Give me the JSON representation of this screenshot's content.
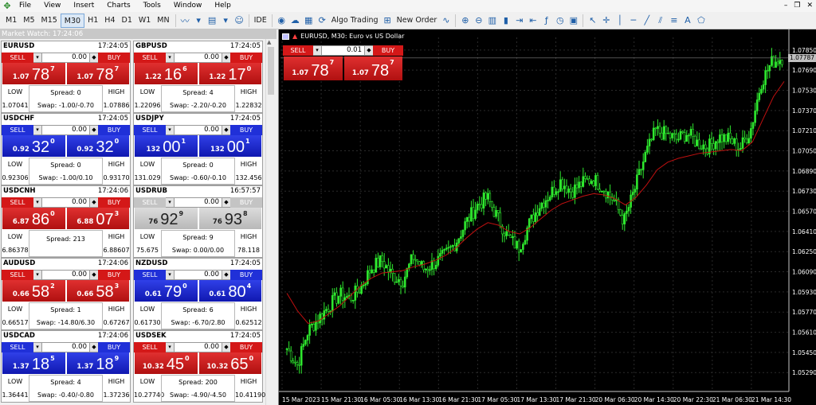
{
  "menu": {
    "items": [
      "File",
      "View",
      "Insert",
      "Charts",
      "Tools",
      "Window",
      "Help"
    ]
  },
  "toolbar": {
    "timeframes": [
      "M1",
      "M5",
      "M15",
      "M30",
      "H1",
      "H4",
      "D1",
      "W1",
      "MN"
    ],
    "active": "M30",
    "ide": "IDE",
    "algo": "Algo Trading",
    "new_order": "New Order"
  },
  "market_watch": {
    "title": "Market Watch: 17:24:06"
  },
  "panels": [
    {
      "symbol": "EURUSD",
      "time": "17:24:05",
      "lot": "0.00",
      "color": "red",
      "sell_label": "SELL",
      "buy_label": "BUY",
      "bid_pfx": "1.07",
      "bid_big": "78",
      "bid_sup": "7",
      "ask_pfx": "1.07",
      "ask_big": "78",
      "ask_sup": "7",
      "low_label": "LOW",
      "low": "1.07041",
      "spread": "Spread: 0",
      "swap": "Swap: -1.00/-0.70",
      "high_label": "HIGH",
      "high": "1.07886"
    },
    {
      "symbol": "GBPUSD",
      "time": "17:24:05",
      "lot": "0.00",
      "color": "red",
      "sell_label": "SELL",
      "buy_label": "BUY",
      "bid_pfx": "1.22",
      "bid_big": "16",
      "bid_sup": "6",
      "ask_pfx": "1.22",
      "ask_big": "17",
      "ask_sup": "0",
      "low_label": "LOW",
      "low": "1.22096",
      "spread": "Spread: 4",
      "swap": "Swap: -2.20/-0.20",
      "high_label": "HIGH",
      "high": "1.22832"
    },
    {
      "symbol": "USDCHF",
      "time": "17:24:05",
      "lot": "0.00",
      "color": "blue",
      "sell_label": "SELL",
      "buy_label": "BUY",
      "bid_pfx": "0.92",
      "bid_big": "32",
      "bid_sup": "0",
      "ask_pfx": "0.92",
      "ask_big": "32",
      "ask_sup": "0",
      "low_label": "LOW",
      "low": "0.92306",
      "spread": "Spread: 0",
      "swap": "Swap: -1.00/0.10",
      "high_label": "HIGH",
      "high": "0.93170"
    },
    {
      "symbol": "USDJPY",
      "time": "17:24:05",
      "lot": "0.00",
      "color": "blue",
      "sell_label": "SELL",
      "buy_label": "BUY",
      "bid_pfx": "132",
      "bid_big": "00",
      "bid_sup": "1",
      "ask_pfx": "132",
      "ask_big": "00",
      "ask_sup": "1",
      "low_label": "LOW",
      "low": "131.029",
      "spread": "Spread: 0",
      "swap": "Swap: -0.60/-0.10",
      "high_label": "HIGH",
      "high": "132.456"
    },
    {
      "symbol": "USDCNH",
      "time": "17:24:06",
      "lot": "0.00",
      "color": "red",
      "sell_label": "SELL",
      "buy_label": "BUY",
      "bid_pfx": "6.87",
      "bid_big": "86",
      "bid_sup": "0",
      "ask_pfx": "6.88",
      "ask_big": "07",
      "ask_sup": "3",
      "low_label": "LOW",
      "low": "6.86378",
      "spread": "Spread: 213",
      "swap": "",
      "high_label": "HIGH",
      "high": "6.88607"
    },
    {
      "symbol": "USDRUB",
      "time": "16:57:57",
      "lot": "0.00",
      "color": "gray",
      "sell_label": "SELL",
      "buy_label": "BUY",
      "bid_pfx": "76",
      "bid_big": "92",
      "bid_sup": "9",
      "ask_pfx": "76",
      "ask_big": "93",
      "ask_sup": "8",
      "low_label": "LOW",
      "low": "75.675",
      "spread": "Spread: 9",
      "swap": "Swap: 0.00/0.00",
      "high_label": "HIGH",
      "high": "78.118"
    },
    {
      "symbol": "AUDUSD",
      "time": "17:24:06",
      "lot": "0.00",
      "color": "red",
      "sell_label": "SELL",
      "buy_label": "BUY",
      "bid_pfx": "0.66",
      "bid_big": "58",
      "bid_sup": "2",
      "ask_pfx": "0.66",
      "ask_big": "58",
      "ask_sup": "3",
      "low_label": "LOW",
      "low": "0.66517",
      "spread": "Spread: 1",
      "swap": "Swap: -14.80/6.30",
      "high_label": "HIGH",
      "high": "0.67267"
    },
    {
      "symbol": "NZDUSD",
      "time": "17:24:05",
      "lot": "0.00",
      "color": "blue",
      "sell_label": "SELL",
      "buy_label": "BUY",
      "bid_pfx": "0.61",
      "bid_big": "79",
      "bid_sup": "0",
      "ask_pfx": "0.61",
      "ask_big": "80",
      "ask_sup": "4",
      "low_label": "LOW",
      "low": "0.61730",
      "spread": "Spread: 6",
      "swap": "Swap: -6.70/2.80",
      "high_label": "HIGH",
      "high": "0.62512"
    },
    {
      "symbol": "USDCAD",
      "time": "17:24:06",
      "lot": "0.00",
      "color": "blue",
      "sell_label": "SELL",
      "buy_label": "BUY",
      "bid_pfx": "1.37",
      "bid_big": "18",
      "bid_sup": "5",
      "ask_pfx": "1.37",
      "ask_big": "18",
      "ask_sup": "9",
      "low_label": "LOW",
      "low": "1.36441",
      "spread": "Spread: 4",
      "swap": "Swap: -0.40/-0.80",
      "high_label": "HIGH",
      "high": "1.37236"
    },
    {
      "symbol": "USDSEK",
      "time": "17:24:05",
      "lot": "0.00",
      "color": "red",
      "sell_label": "SELL",
      "buy_label": "BUY",
      "bid_pfx": "10.32",
      "bid_big": "45",
      "bid_sup": "0",
      "ask_pfx": "10.32",
      "ask_big": "65",
      "ask_sup": "0",
      "low_label": "LOW",
      "low": "10.27740",
      "spread": "Spread: 200",
      "swap": "Swap: -4.90/-4.50",
      "high_label": "HIGH",
      "high": "10.41190"
    }
  ],
  "chart": {
    "title": "EURUSD, M30:  Euro vs US Dollar",
    "trade": {
      "sell_label": "SELL",
      "buy_label": "BUY",
      "lot": "0.01",
      "bid_pfx": "1.07",
      "bid_big": "78",
      "bid_sup": "7",
      "ask_pfx": "1.07",
      "ask_big": "78",
      "ask_sup": "7"
    },
    "current_price": "1.07787",
    "candle_color": "#2ee82e",
    "ma_color": "#c01010"
  },
  "chart_data": {
    "type": "candlestick",
    "ylim": [
      1.0514,
      1.0795
    ],
    "yticks": [
      "1.07850",
      "1.07690",
      "1.07530",
      "1.07370",
      "1.07210",
      "1.07050",
      "1.06890",
      "1.06730",
      "1.06570",
      "1.06410",
      "1.06250",
      "1.06090",
      "1.05930",
      "1.05770",
      "1.05610",
      "1.05450",
      "1.05290"
    ],
    "xticks": [
      "15 Mar 2023",
      "15 Mar 21:30",
      "16 Mar 05:30",
      "16 Mar 13:30",
      "16 Mar 21:30",
      "17 Mar 05:30",
      "17 Mar 13:30",
      "17 Mar 21:30",
      "20 Mar 06:30",
      "20 Mar 14:30",
      "20 Mar 22:30",
      "21 Mar 06:30",
      "21 Mar 14:30"
    ],
    "close_path": [
      1.0548,
      1.0535,
      1.0562,
      1.0572,
      1.0582,
      1.0591,
      1.0588,
      1.0596,
      1.0612,
      1.0618,
      1.0606,
      1.0602,
      1.0621,
      1.0611,
      1.0616,
      1.0622,
      1.0632,
      1.0648,
      1.0661,
      1.0668,
      1.0652,
      1.0636,
      1.0628,
      1.0647,
      1.0662,
      1.0671,
      1.0681,
      1.0673,
      1.0679,
      1.0683,
      1.0676,
      1.0666,
      1.0649,
      1.0674,
      1.0701,
      1.0721,
      1.0718,
      1.0714,
      1.0719,
      1.0711,
      1.0708,
      1.0716,
      1.0714,
      1.0707,
      1.0721,
      1.0759,
      1.0775,
      1.0779
    ],
    "ma_path": [
      1.0592,
      1.0578,
      1.0568,
      1.057,
      1.0576,
      1.0582,
      1.059,
      1.0598,
      1.0604,
      1.0608,
      1.0609,
      1.061,
      1.0613,
      1.0615,
      1.0618,
      1.0622,
      1.0628,
      1.0636,
      1.0643,
      1.0648,
      1.0646,
      1.0641,
      1.0639,
      1.0644,
      1.0651,
      1.0658,
      1.0663,
      1.0666,
      1.0669,
      1.0671,
      1.067,
      1.0667,
      1.0662,
      1.0668,
      1.0678,
      1.069,
      1.0696,
      1.0699,
      1.0701,
      1.0703,
      1.0704,
      1.0705,
      1.0706,
      1.0705,
      1.0712,
      1.073,
      1.0748,
      1.076
    ]
  }
}
